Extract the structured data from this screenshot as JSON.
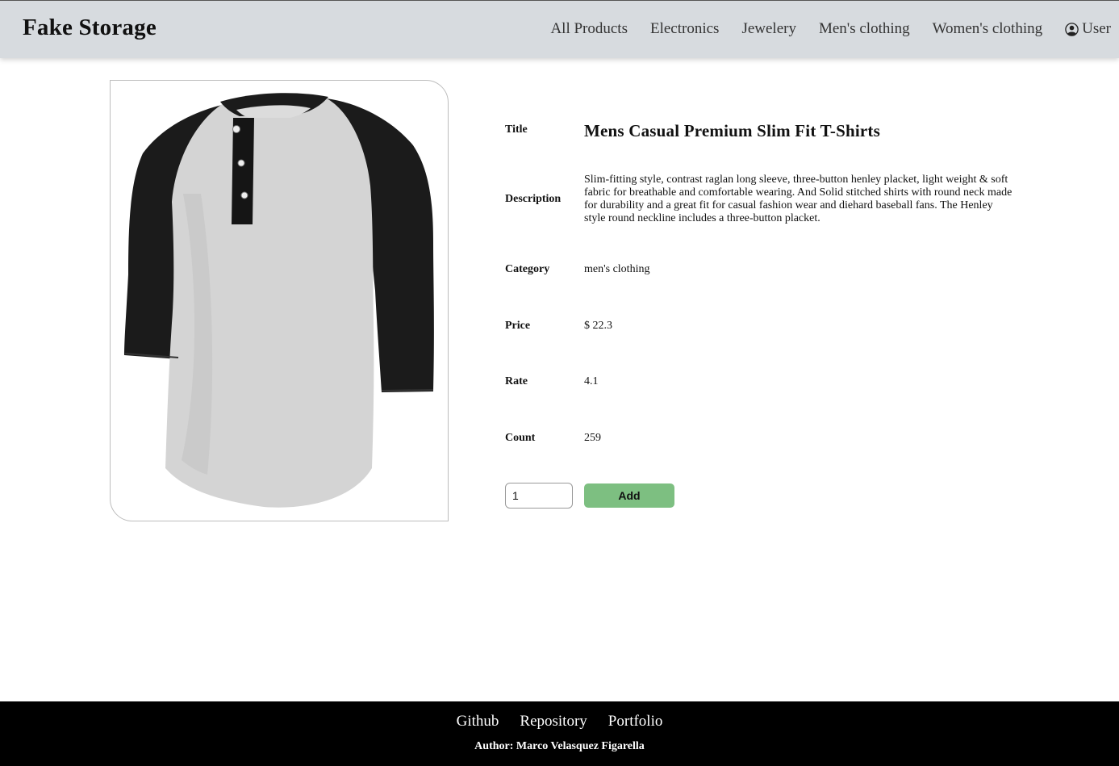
{
  "header": {
    "brand": "Fake Storage",
    "nav": [
      "All Products",
      "Electronics",
      "Jewelery",
      "Men's clothing",
      "Women's clothing"
    ],
    "user_label": "User",
    "background_color": "#d7dbdf"
  },
  "product": {
    "image_icon": "raglan-henley-shirt-image",
    "fields": {
      "title_label": "Title",
      "title": "Mens Casual Premium Slim Fit T-Shirts",
      "description_label": "Description",
      "description": "Slim-fitting style, contrast raglan long sleeve, three-button henley placket, light weight & soft fabric for breathable and comfortable wearing. And Solid stitched shirts with round neck made for durability and a great fit for casual fashion wear and diehard baseball fans. The Henley style round neckline includes a three-button placket.",
      "category_label": "Category",
      "category": "men's clothing",
      "price_label": "Price",
      "price": "$ 22.3",
      "rate_label": "Rate",
      "rate": "4.1",
      "count_label": "Count",
      "count": "259"
    },
    "quantity_value": "1",
    "add_label": "Add",
    "add_button_color": "#7dbf81"
  },
  "footer": {
    "links": [
      "Github",
      "Repository",
      "Portfolio"
    ],
    "author": "Author: Marco Velasquez Figarella",
    "background_color": "#000000"
  }
}
